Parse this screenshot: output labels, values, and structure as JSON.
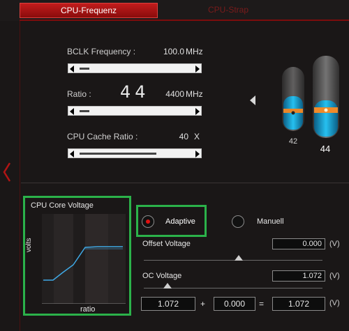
{
  "tabs": {
    "active": "CPU-Frequenz",
    "inactive": "CPU-Strap"
  },
  "frequency": {
    "bclk_label": "BCLK Frequency :",
    "bclk_value": "100.0",
    "bclk_unit": "MHz",
    "ratio_label": "Ratio :",
    "ratio_big": "44",
    "ratio_freq": "4400",
    "ratio_unit": "MHz",
    "cache_label": "CPU Cache Ratio :",
    "cache_value": "40",
    "cache_unit": "X"
  },
  "gauges": {
    "left_value": "42",
    "right_value": "44",
    "left_level": 0.45,
    "right_level": 0.55
  },
  "voltage_chart": {
    "title": "CPU Core Voltage",
    "ylabel": "volts",
    "xlabel": "ratio"
  },
  "mode": {
    "adaptive_label": "Adaptive",
    "manual_label": "Manuell",
    "selected": "Adaptive"
  },
  "offset_voltage": {
    "label": "Offset Voltage",
    "value": "0.000",
    "unit": "(V)"
  },
  "oc_voltage": {
    "label": "OC Voltage",
    "value": "1.072",
    "unit": "(V)"
  },
  "equation": {
    "a": "1.072",
    "plus": "+",
    "b": "0.000",
    "equals": "=",
    "result": "1.072",
    "unit": "(V)"
  },
  "colors": {
    "accent_red": "#c21c1c",
    "highlight_green": "#2bb24a",
    "gauge_blue": "#1aa7d8",
    "gauge_orange": "#f08a2a"
  }
}
